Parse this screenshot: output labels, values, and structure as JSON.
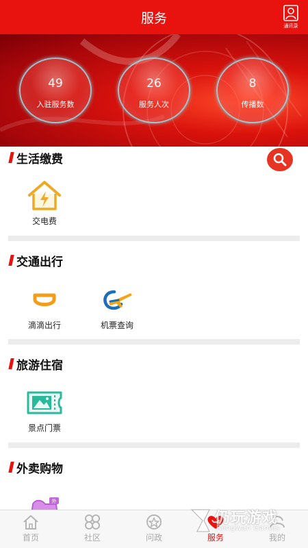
{
  "header": {
    "title": "服务",
    "contacts_label": "通讯录"
  },
  "stats": [
    {
      "value": "49",
      "label": "入驻服务数"
    },
    {
      "value": "26",
      "label": "服务人次"
    },
    {
      "value": "8",
      "label": "传播数"
    }
  ],
  "sections": [
    {
      "title": "生活缴费",
      "items": [
        {
          "label": "交电费",
          "icon": "electricity-house-icon"
        }
      ]
    },
    {
      "title": "交通出行",
      "items": [
        {
          "label": "滴滴出行",
          "icon": "didi-icon"
        },
        {
          "label": "机票查询",
          "icon": "airplane-icon"
        }
      ]
    },
    {
      "title": "旅游住宿",
      "items": [
        {
          "label": "景点门票",
          "icon": "ticket-icon"
        }
      ]
    },
    {
      "title": "外卖购物",
      "items": [
        {
          "label": "",
          "icon": "takeout-icon"
        }
      ]
    }
  ],
  "tabs": [
    {
      "label": "首页",
      "icon": "home-icon"
    },
    {
      "label": "社区",
      "icon": "community-icon"
    },
    {
      "label": "问政",
      "icon": "inquiry-icon"
    },
    {
      "label": "服务",
      "icon": "service-heart-icon",
      "active": true
    },
    {
      "label": "我的",
      "icon": "profile-icon"
    }
  ],
  "watermark": {
    "brand": "仍玩游戏",
    "sub": "Rengwan Games"
  },
  "colors": {
    "brand_red": "#e8130f",
    "divider": "#ececec",
    "tab_inactive": "#aaaaaa"
  }
}
